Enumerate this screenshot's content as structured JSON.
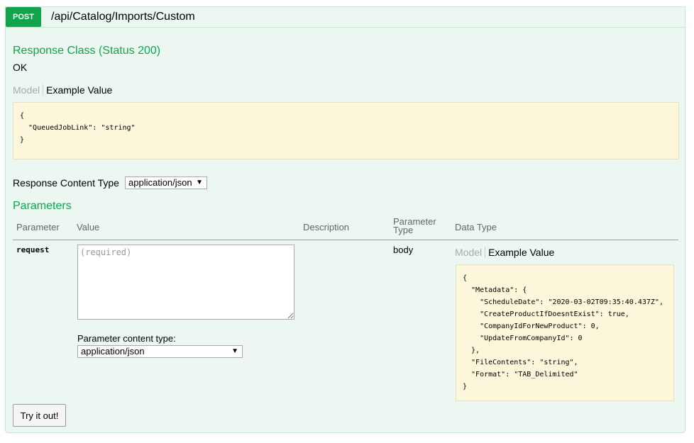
{
  "operation": {
    "method": "POST",
    "path": "/api/Catalog/Imports/Custom"
  },
  "response_class": {
    "title": "Response Class (Status 200)",
    "status_text": "OK",
    "tabs": {
      "model": "Model",
      "example": "Example Value"
    },
    "example_json": "{\n  \"QueuedJobLink\": \"string\"\n}"
  },
  "response_content_type": {
    "label": "Response Content Type",
    "selected": "application/json"
  },
  "parameters": {
    "title": "Parameters",
    "headers": {
      "parameter": "Parameter",
      "value": "Value",
      "description": "Description",
      "parameter_type": "Parameter Type",
      "data_type": "Data Type"
    },
    "rows": [
      {
        "name": "request",
        "placeholder": "(required)",
        "parameter_type": "body",
        "content_type_label": "Parameter content type:",
        "content_type_selected": "application/json",
        "tabs": {
          "model": "Model",
          "example": "Example Value"
        },
        "example_json": "{\n  \"Metadata\": {\n    \"ScheduleDate\": \"2020-03-02T09:35:40.437Z\",\n    \"CreateProductIfDoesntExist\": true,\n    \"CompanyIdForNewProduct\": 0,\n    \"UpdateFromCompanyId\": 0\n  },\n  \"FileContents\": \"string\",\n  \"Format\": \"TAB_Delimited\"\n}"
      }
    ]
  },
  "try_button": {
    "label": "Try it out!"
  },
  "colors": {
    "method_post": "#10a54a",
    "panel_bg": "#ebf7f0",
    "code_bg": "#fcf6db"
  }
}
